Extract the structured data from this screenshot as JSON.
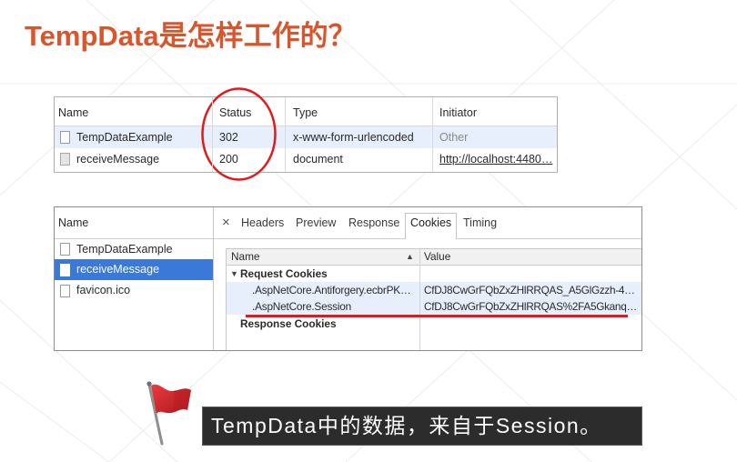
{
  "slide": {
    "title": "TempData是怎样工作的？",
    "caption": "TempData中的数据，来自于Session。"
  },
  "colors": {
    "title": "#D9552C",
    "annotation": "#E21A1C",
    "row_highlight": "#E6EFFB",
    "row_selected": "#3A79D8",
    "caption_background": "#2C2C2C"
  },
  "icons": {
    "request_document": "file-icon",
    "close": "close-icon",
    "sort": "sort-ascending-icon",
    "expand": "expand-triangle-icon",
    "flag": "flag-icon"
  },
  "network_table": {
    "columns": [
      "Name",
      "Status",
      "Type",
      "Initiator"
    ],
    "rows": [
      {
        "name": "TempDataExample",
        "status": "302",
        "type": "x-www-form-urlencoded",
        "initiator": "Other"
      },
      {
        "name": "receiveMessage",
        "status": "200",
        "type": "document",
        "initiator": "http://localhost:4480…"
      }
    ]
  },
  "detail_panel": {
    "list_header": "Name",
    "requests": [
      "TempDataExample",
      "receiveMessage",
      "favicon.ico"
    ],
    "selected_request_index": 1,
    "close_glyph": "×",
    "tabs": [
      "Headers",
      "Preview",
      "Response",
      "Cookies",
      "Timing"
    ],
    "active_tab_index": 3,
    "cookies": {
      "columns": [
        "Name",
        "Value"
      ],
      "sort_glyph": "▲",
      "expand_glyph": "▼",
      "request_section": "Request Cookies",
      "request_cookies": [
        {
          "name": ".AspNetCore.Antiforgery.ecbrPK…",
          "value": "CfDJ8CwGrFQbZxZHlRRQAS_A5GlGzzh-4…"
        },
        {
          "name": ".AspNetCore.Session",
          "value": "CfDJ8CwGrFQbZxZHlRRQAS%2FA5Gkanq…"
        }
      ],
      "response_section": "Response Cookies"
    }
  }
}
